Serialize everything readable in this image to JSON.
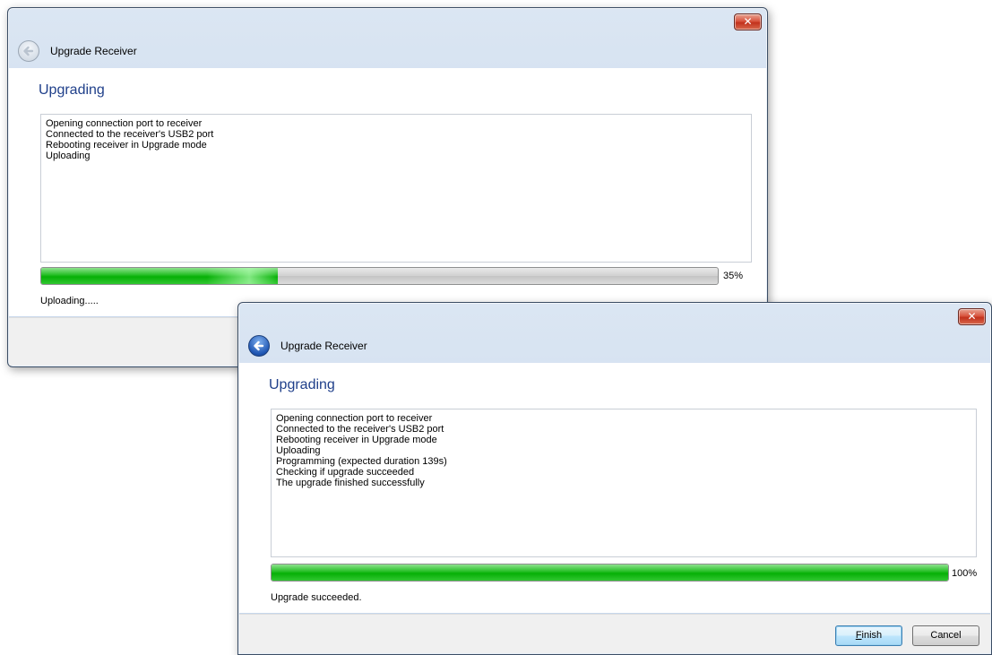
{
  "windows": [
    {
      "title": "Upgrade Receiver",
      "close_glyph": "✕",
      "back_icon": "back-arrow-icon",
      "back_enabled": false,
      "heading": "Upgrading",
      "log": [
        "Opening connection port to receiver",
        "Connected to the receiver's USB2 port",
        "Rebooting receiver in Upgrade mode",
        "Uploading"
      ],
      "progress_value": 0.35,
      "progress_label": "35%",
      "status": "Uploading....."
    },
    {
      "title": "Upgrade Receiver",
      "close_glyph": "✕",
      "back_icon": "back-arrow-icon",
      "back_enabled": true,
      "heading": "Upgrading",
      "log": [
        "Opening connection port to receiver",
        "Connected to the receiver's USB2 port",
        "Rebooting receiver in Upgrade mode",
        "Uploading",
        "Programming (expected duration 139s)",
        "Checking if upgrade succeeded",
        "The upgrade finished successfully"
      ],
      "progress_value": 1.0,
      "progress_label": "100%",
      "status": "Upgrade succeeded.",
      "buttons": {
        "finish_mnemonic": "F",
        "finish_rest": "inish",
        "cancel": "Cancel"
      }
    }
  ],
  "colors": {
    "heading": "#1f3f8a",
    "progress_green": "#06b006",
    "close_red": "#c2321d"
  }
}
